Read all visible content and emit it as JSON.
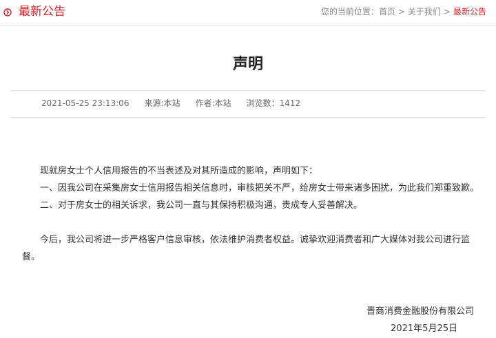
{
  "header": {
    "title": "最新公告",
    "icon": "circle-chevron-right-icon",
    "accent_color": "#d71921"
  },
  "breadcrumb": {
    "prefix": "您的当前位置：",
    "items": [
      "首页",
      "关于我们",
      "最新公告"
    ],
    "separator": ">"
  },
  "article": {
    "title": "声明",
    "meta": {
      "datetime": "2021-05-25 23:13:06",
      "source": "来源:本站",
      "author": "作者:本站",
      "views": "浏览数：1412"
    },
    "paragraphs": [
      "现就房女士个人信用报告的不当表述及对其所造成的影响，声明如下：",
      "一、因我公司在采集房女士信用报告相关信息时，审核把关不严，给房女士带来诸多困扰，为此我们郑重致歉。",
      "二、对于房女士的相关诉求，我公司一直与其保持积极沟通，责成专人妥善解决。",
      "今后，我公司将进一步严格客户信息审核，依法维护消费者权益。诚挚欢迎消费者和广大媒体对我公司进行监督。"
    ],
    "signature": {
      "company": "晋商消费金融股份有限公司",
      "date": "2021年5月25日"
    }
  }
}
